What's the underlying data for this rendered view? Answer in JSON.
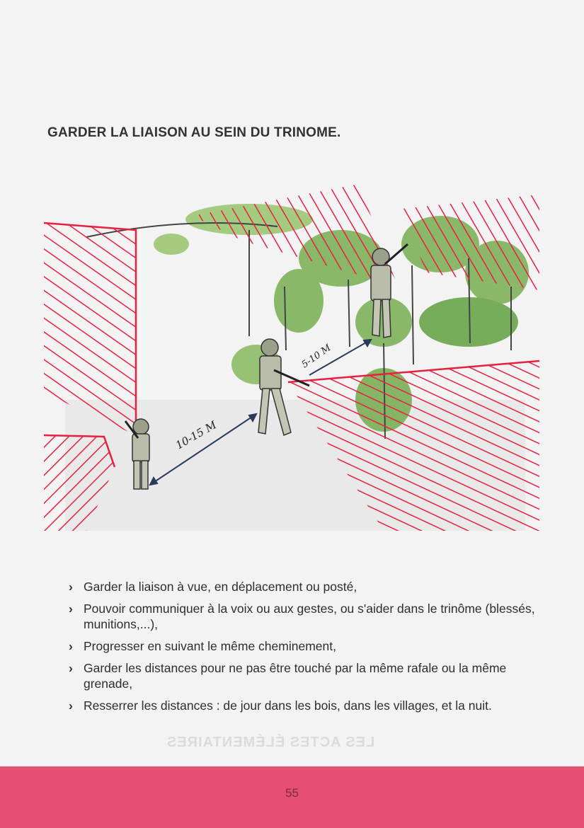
{
  "page": {
    "title": "GARDER LA LIAISON AU SEIN DU TRINOME.",
    "page_number": "55",
    "footer_color": "#e64e72",
    "accent_color": "#e8203f"
  },
  "illustration": {
    "distance_label_1": "10-15 M",
    "distance_label_2": "5-10 M",
    "icons": [
      "soldier-1-icon",
      "soldier-2-icon",
      "soldier-3-icon",
      "tree-icon",
      "hatched-danger-zone-icon",
      "distance-arrow-icon"
    ]
  },
  "bullets": {
    "marker": "›",
    "items": [
      "Garder la liaison à vue, en déplacement ou posté,",
      "Pouvoir communiquer à la voix ou aux gestes, ou s'aider dans le trinôme (blessés, munitions,...),",
      "Progresser en suivant le même cheminement,",
      "Garder les distances pour ne pas être touché par la même rafale ou la même grenade,",
      "Resserrer les distances : de jour dans les bois, dans les villages, et la nuit."
    ]
  },
  "bleed_through": "LES ACTES ÉLÉMENTAIRES"
}
